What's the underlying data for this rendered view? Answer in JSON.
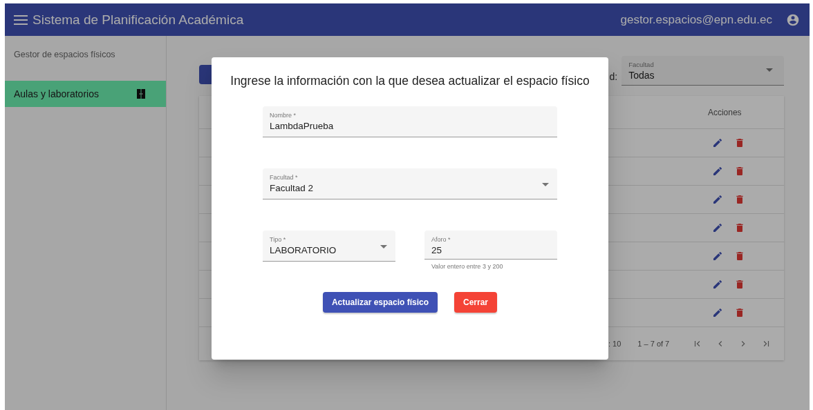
{
  "toolbar": {
    "title": "Sistema de Planificación Académica",
    "user": "gestor.espacios@epn.edu.ec"
  },
  "sidebar": {
    "heading": "Gestor de espacios físicos",
    "items": [
      {
        "label": "Aulas y laboratorios",
        "selected": true
      }
    ]
  },
  "filter": {
    "label_fragment": "d:",
    "label": "Facultad",
    "value": "Todas"
  },
  "table": {
    "header": "Acciones",
    "rows": [
      {
        "actions": [
          {
            "kind": "edit"
          },
          {
            "kind": "delete"
          }
        ]
      },
      {
        "actions": [
          {
            "kind": "edit"
          },
          {
            "kind": "delete"
          }
        ]
      },
      {
        "actions": [
          {
            "kind": "edit"
          },
          {
            "kind": "delete"
          }
        ]
      },
      {
        "actions": [
          {
            "kind": "edit"
          },
          {
            "kind": "delete"
          }
        ]
      },
      {
        "actions": [
          {
            "kind": "edit"
          },
          {
            "kind": "delete"
          }
        ]
      },
      {
        "actions": [
          {
            "kind": "edit"
          },
          {
            "kind": "delete"
          }
        ]
      },
      {
        "actions": [
          {
            "kind": "edit"
          },
          {
            "kind": "delete"
          }
        ]
      }
    ]
  },
  "paginator": {
    "page_size_fragment": ": 10",
    "range": "1 – 7 of 7"
  },
  "dialog": {
    "title": "Ingrese la información con la que desea actualizar el espacio físico",
    "rows": [
      [
        {
          "kind": "input",
          "label": "Nombre *",
          "value": "LambdaPrueba"
        }
      ],
      [
        {
          "kind": "select",
          "label": "Facultad *",
          "value": "Facultad 2"
        }
      ],
      [
        {
          "kind": "select",
          "label": "Tipo *",
          "value": "LABORATORIO"
        },
        {
          "kind": "input",
          "label": "Aforo *",
          "value": "25",
          "hint": "Valor entero entre 3 y 200"
        }
      ]
    ],
    "buttons": [
      {
        "label": "Actualizar espacio físico",
        "kind": "primary"
      },
      {
        "label": "Cerrar",
        "kind": "warn"
      }
    ]
  }
}
